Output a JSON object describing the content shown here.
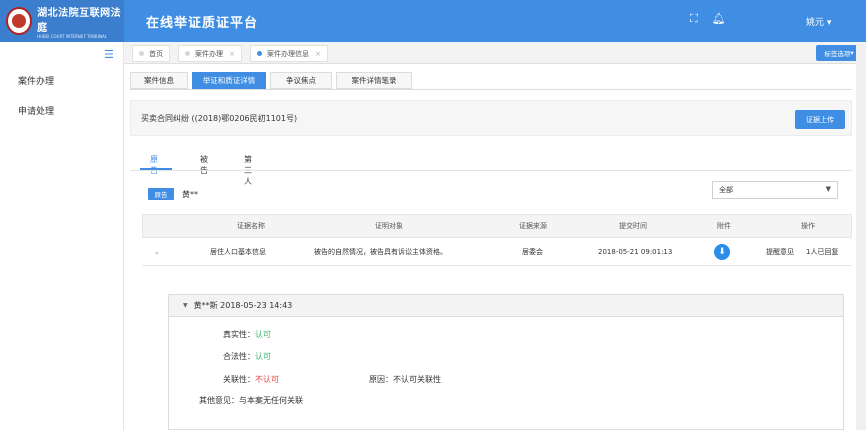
{
  "header": {
    "logo_cn": "湖北法院互联网法庭",
    "logo_en": "HUBEI COURT INTERNET TRIBUNAL",
    "app_title": "在线举证质证平台",
    "user_name": "姚元"
  },
  "sidebar": {
    "items": [
      {
        "label": "案件办理"
      },
      {
        "label": "申请处理"
      }
    ]
  },
  "tabbar": {
    "tabs": [
      {
        "label": "首页",
        "active": false
      },
      {
        "label": "案件办理",
        "active": false
      },
      {
        "label": "案件办理信息",
        "active": true
      }
    ],
    "select_label": "标签选项"
  },
  "subtabs": [
    {
      "label": "案件信息",
      "active": false
    },
    {
      "label": "举证和质证详情",
      "active": true
    },
    {
      "label": "争议焦点",
      "active": false
    },
    {
      "label": "案件详情笔录",
      "active": false
    }
  ],
  "case": {
    "title": "买卖合同纠纷  ((2018)鄂0206民初1101号)",
    "upload_label": "证据上传"
  },
  "party_tabs": [
    {
      "label": "原告",
      "active": true
    },
    {
      "label": "被告",
      "active": false
    },
    {
      "label": "第三人",
      "active": false
    }
  ],
  "party": {
    "badge": "原告",
    "name": "黄**",
    "filter_value": "全部"
  },
  "table": {
    "headers": [
      "证据名称",
      "证明对象",
      "证据来源",
      "提交时间",
      "附件",
      "操作"
    ],
    "rows": [
      {
        "toggle": "⌄",
        "name": "居住人口基本信息",
        "object": "被告的自然情况，被告具有诉讼主体资格。",
        "source": "居委会",
        "time": "2018-05-21 09:01:13",
        "action_feedback": "提醒意见",
        "action_count": "1人已回复"
      }
    ]
  },
  "detail": {
    "header": "黄**斯  2018-05-23  14:43",
    "authenticity_label": "真实性：",
    "authenticity_value": "认可",
    "legality_label": "合法性：",
    "legality_value": "认可",
    "relevance_label": "关联性：",
    "relevance_value": "不认可",
    "reason_label": "原因：",
    "reason_value": "不认可关联性",
    "other_label": "其他意见：",
    "other_value": "与本案无任何关联"
  },
  "colors": {
    "primary": "#3f8ee3",
    "success": "#3cb66a",
    "danger": "#e64545"
  }
}
